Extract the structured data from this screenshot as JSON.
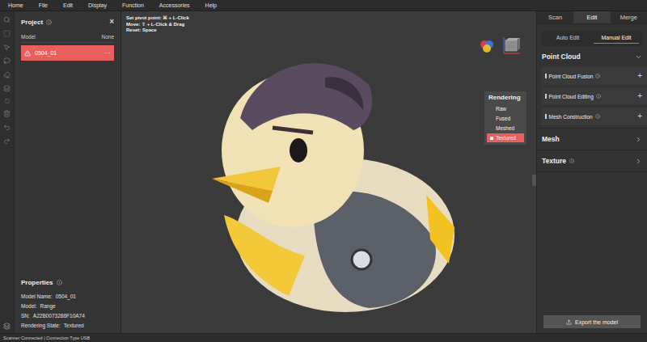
{
  "menu": [
    "Home",
    "File",
    "Edit",
    "Display",
    "Function",
    "Accessories",
    "Help"
  ],
  "project": {
    "title": "Project",
    "close": "×",
    "columns": [
      "Model",
      "None"
    ],
    "models": [
      {
        "name": "0504_01",
        "warning": true,
        "more": "···",
        "selected": true
      }
    ]
  },
  "properties": {
    "title": "Properties",
    "fields": [
      {
        "label": "Model Name:",
        "value": "0504_01"
      },
      {
        "label": "Model:",
        "value": "Range"
      },
      {
        "label": "SN:",
        "value": "A22B0073286F10A74"
      },
      {
        "label": "Rendering State:",
        "value": "Textured"
      }
    ]
  },
  "viewport": {
    "hints": [
      "Set pivot point: ⌘ + L-Click",
      "Move: ⇧ + L-Click & Drag",
      "Reset: Space"
    ]
  },
  "rendering": {
    "title": "Rendering",
    "options": [
      {
        "label": "Raw",
        "selected": false
      },
      {
        "label": "Fused",
        "selected": false
      },
      {
        "label": "Meshed",
        "selected": false
      },
      {
        "label": "Textured",
        "selected": true
      }
    ]
  },
  "right_panel": {
    "tabs": [
      {
        "label": "Scan",
        "selected": false
      },
      {
        "label": "Edit",
        "selected": true
      },
      {
        "label": "Merge",
        "selected": false
      }
    ],
    "subtabs": [
      {
        "label": "Auto Edit",
        "selected": false
      },
      {
        "label": "Manual Edit",
        "selected": true
      }
    ],
    "sections": [
      {
        "label": "Point Cloud",
        "expanded": true,
        "info": false,
        "items": [
          {
            "label": "Point Cloud Fusion",
            "info": true,
            "action": "+"
          },
          {
            "label": "Point Cloud Editing",
            "info": true,
            "action": "+"
          },
          {
            "label": "Mesh Construction",
            "info": true,
            "action": "+"
          }
        ]
      },
      {
        "label": "Mesh",
        "expanded": false,
        "info": false,
        "items": []
      },
      {
        "label": "Texture",
        "expanded": false,
        "info": true,
        "items": []
      }
    ],
    "export_button": "Export the model"
  },
  "status_bar": "Scanner Connected | Connection Type USB"
}
